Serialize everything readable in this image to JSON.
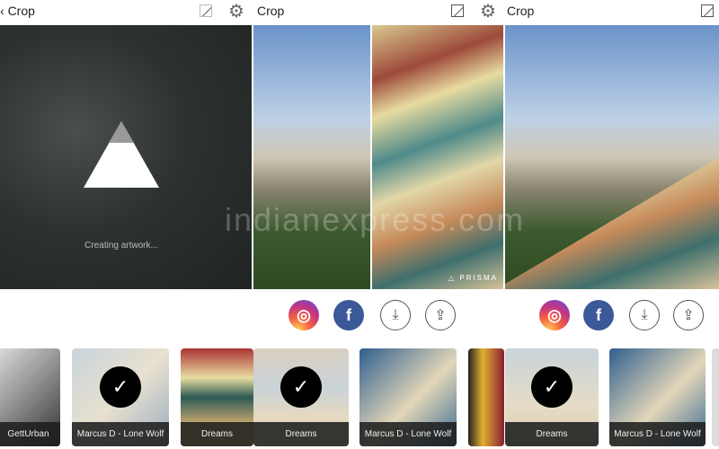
{
  "panels": [
    {
      "title": "Crop",
      "status": "Creating artwork..."
    },
    {
      "title": "Crop",
      "watermark": "PRISMA"
    },
    {
      "title": "Crop"
    }
  ],
  "share_icons": [
    "instagram-icon",
    "facebook-icon",
    "download-icon",
    "share-icon"
  ],
  "facebook_letter": "f",
  "filters": [
    {
      "label": "GettUrban",
      "selected": false
    },
    {
      "label": "Marcus D - Lone Wolf",
      "selected": true
    },
    {
      "label": "Dreams",
      "selected": false
    },
    {
      "label": "Dreams",
      "selected": true
    },
    {
      "label": "Marcus D - Lone Wolf",
      "selected": false
    },
    {
      "label": "Dreams",
      "selected": true
    },
    {
      "label": "Marcus D - Lone Wolf",
      "selected": false
    }
  ],
  "site_watermark": "indianexpress.com",
  "check_glyph": "✓"
}
